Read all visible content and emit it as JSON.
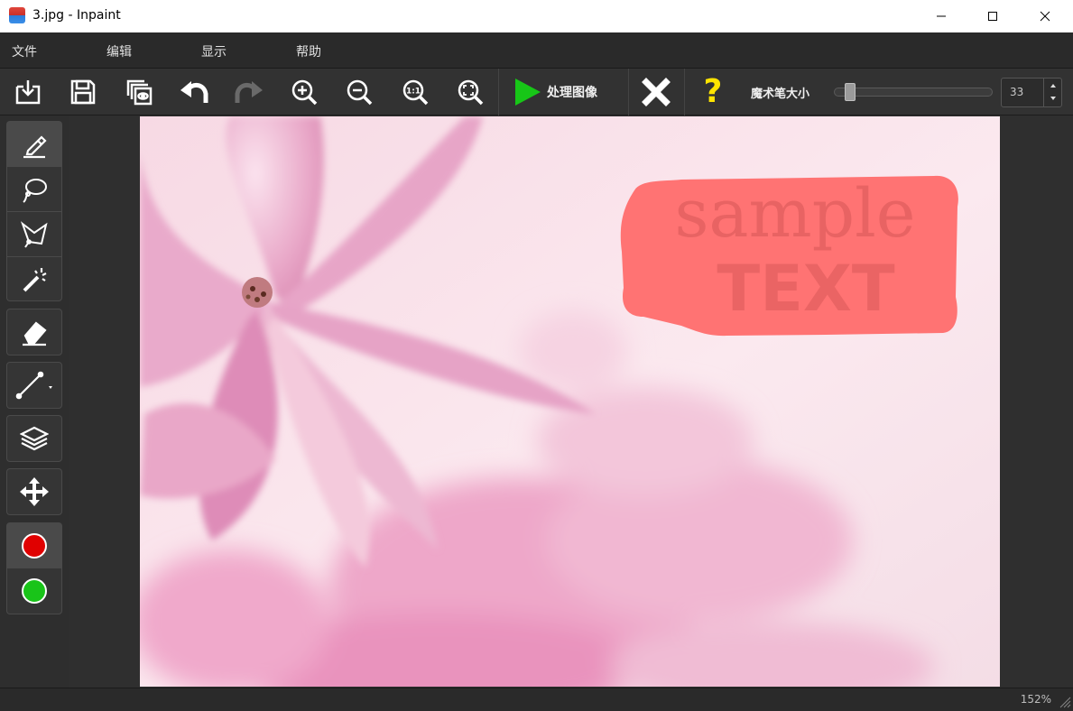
{
  "window": {
    "title": "3.jpg - Inpaint"
  },
  "menu": {
    "items": [
      "文件",
      "编辑",
      "显示",
      "帮助"
    ]
  },
  "toolbar": {
    "icons": [
      "open-icon",
      "save-icon",
      "preview-icon",
      "undo-icon",
      "redo-icon",
      "zoom-in-icon",
      "zoom-out-icon",
      "zoom-actual-icon",
      "zoom-fit-icon"
    ],
    "zoom_actual_glyph": "1:1",
    "process_label": "处理图像",
    "help_glyph": "?",
    "brush_size_label": "魔术笔大小",
    "brush_size_value": "33",
    "brush_slider_value": 0.05
  },
  "tools": {
    "selection": [
      "marker-icon",
      "lasso-icon",
      "polygon-lasso-icon",
      "magic-wand-icon"
    ],
    "eraser": "eraser-icon",
    "line": "line-icon",
    "layers": "layers-icon",
    "move": "move-icon",
    "colors": [
      "#e00000",
      "#19c419"
    ]
  },
  "image": {
    "text_line1": "sample",
    "text_line2": "TEXT",
    "mask_color": "#ff7373"
  },
  "status": {
    "zoom": "152%"
  }
}
